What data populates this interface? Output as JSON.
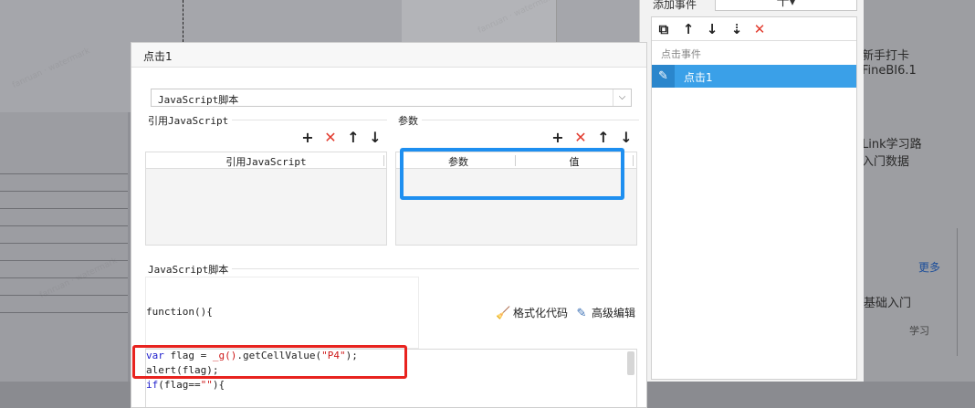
{
  "dialog": {
    "title": "点击1",
    "type_select": {
      "value": "JavaScript脚本"
    },
    "ref_js": {
      "section_label": "引用JavaScript",
      "column_header": "引用JavaScript"
    },
    "params": {
      "section_label": "参数",
      "columns": [
        "参数",
        "值"
      ]
    },
    "script": {
      "section_label": "JavaScript脚本",
      "fn_header": "function(){",
      "format_label": "格式化代码",
      "advanced_label": "高级编辑",
      "lines": [
        {
          "keyword": "var",
          "ident": " flag = ",
          "call": "_g()",
          "rest": ".getCellValue(",
          "string": "\"P4\"",
          "tail": ");"
        },
        {
          "keyword": "",
          "ident": "alert(flag);",
          "call": "",
          "rest": "",
          "string": "",
          "tail": ""
        },
        {
          "keyword": "if",
          "ident": "(flag==",
          "call": "",
          "rest": "",
          "string": "\"\"",
          "tail": "){"
        }
      ]
    },
    "highlight_colors": {
      "params_box": "#1e8ff0",
      "code_box": "#e8231f"
    }
  },
  "event_panel": {
    "add_event_label": "添加事件",
    "add_button_label": "十▾",
    "section_label": "点击事件",
    "items": [
      {
        "label": "点击1",
        "selected": true
      }
    ],
    "toolbar_icons": [
      "copy-icon",
      "arrow-up-icon",
      "arrow-down-icon",
      "move-bottom-icon",
      "delete-icon"
    ]
  },
  "background": {
    "right_texts": [
      "新手打卡",
      "FineBI6.1",
      "Link学习路",
      "入门数据",
      "基础入门"
    ],
    "more_link": "更多",
    "learn_label": "学习"
  },
  "colors": {
    "accent_blue": "#3aa0e8",
    "delete_red": "#e23b2e"
  }
}
